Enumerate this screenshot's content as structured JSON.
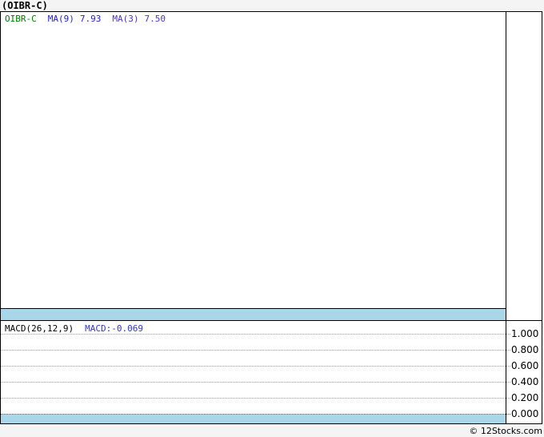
{
  "page": {
    "background": "#f4f4f4"
  },
  "header": {
    "title": "(OIBR-C)"
  },
  "price_panel": {
    "legend": {
      "symbol": "OIBR-C",
      "ma9_label": "MA(9)",
      "ma9_value": "7.93",
      "ma3_label": "MA(3)",
      "ma3_value": "7.50"
    },
    "colors": {
      "symbol": "#007a00",
      "ma9": "#2222cc",
      "ma3": "#4a35c9",
      "band": "#a9d7e8"
    }
  },
  "macd_panel": {
    "label": "MACD(26,12,9)",
    "value_text": "MACD:-0.069",
    "value_color": "#3333cc",
    "axis_ticks": [
      "1.000",
      "0.800",
      "0.600",
      "0.400",
      "0.200",
      "0.000"
    ]
  },
  "footer": {
    "credit": "© 12Stocks.com"
  },
  "chart_data": [
    {
      "type": "line",
      "title": "OIBR-C price panel",
      "series": [
        {
          "name": "OIBR-C",
          "color": "#007a00",
          "values": []
        },
        {
          "name": "MA(9)",
          "color": "#2222cc",
          "last_value": 7.93
        },
        {
          "name": "MA(3)",
          "color": "#4a35c9",
          "last_value": 7.5
        }
      ],
      "note": "plot area renders empty/blank in screenshot; only legend values visible",
      "grid": false,
      "legend_position": "top-left"
    },
    {
      "type": "line",
      "title": "MACD(26,12,9)",
      "series": [
        {
          "name": "MACD",
          "last_value": -0.069
        }
      ],
      "ylim": [
        0.0,
        1.0
      ],
      "yticks": [
        1.0,
        0.8,
        0.6,
        0.4,
        0.2,
        0.0
      ],
      "ylabel": "",
      "xlabel": "",
      "grid": true,
      "note": "horizontal dotted gridlines only; no curve visible in plot area"
    }
  ]
}
